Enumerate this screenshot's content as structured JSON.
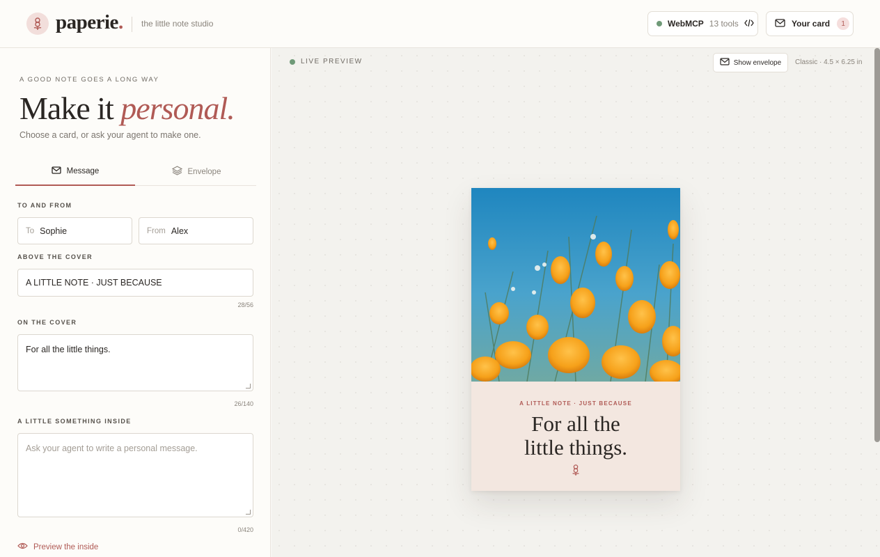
{
  "header": {
    "brand": "paperie",
    "brand_dot": ".",
    "tagline": "the little note studio",
    "webmcp_label": "WebMCP",
    "webmcp_tools": "13 tools",
    "card_label": "Your card",
    "card_count": "1"
  },
  "left": {
    "eyebrow": "A GOOD NOTE GOES A LONG WAY",
    "hero_plain": "Make it ",
    "hero_accent": "personal.",
    "subtitle": "Choose a card, or ask your agent to make one.",
    "tabs": [
      {
        "label": "Message",
        "active": true
      },
      {
        "label": "Envelope",
        "active": false
      }
    ],
    "to_from_label": "TO AND FROM",
    "to": {
      "prefix": "To",
      "value": "Sophie"
    },
    "from": {
      "prefix": "From",
      "value": "Alex"
    },
    "above_cover_label": "ABOVE THE COVER",
    "above_cover_value": "A LITTLE NOTE · JUST BECAUSE",
    "above_cover_count": "28/56",
    "on_cover_label": "ON THE COVER",
    "on_cover_value": "For all the little things.",
    "on_cover_count": "26/140",
    "inside_label": "A LITTLE SOMETHING INSIDE",
    "inside_placeholder": "Ask your agent to write a personal message.",
    "inside_count": "0/420",
    "preview_link": "Preview the inside"
  },
  "canvas": {
    "live_label": "LIVE PREVIEW",
    "envelope_button": "Show envelope",
    "card_meta": "Classic · 4.5 × 6.25 in"
  },
  "card": {
    "eyebrow": "A LITTLE NOTE · JUST BECAUSE",
    "title_line1": "For all the",
    "title_line2": "little things."
  },
  "colors": {
    "accent": "#b05a55",
    "live_dot": "#6f9a78",
    "card_bg": "#f3e7e0"
  }
}
